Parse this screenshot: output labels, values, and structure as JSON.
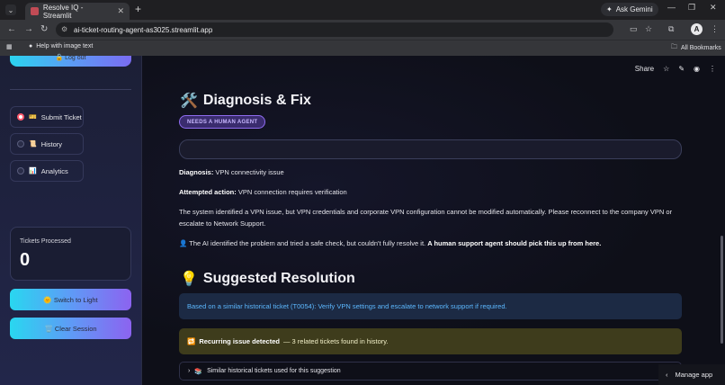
{
  "browser": {
    "tab_title": "Resolve IQ - Streamlit",
    "new_tab": "+",
    "gemini_label": "Ask Gemini",
    "url": "ai-ticket-routing-agent-as3025.streamlit.app",
    "bookmark_help": "Help with image text",
    "bookmark_all": "All Bookmarks",
    "profile_initial": "A"
  },
  "sidebar": {
    "logout_label": "🔓 Log out",
    "nav": [
      {
        "icon": "🎫",
        "label": "Submit Ticket",
        "selected": true
      },
      {
        "icon": "📜",
        "label": "History",
        "selected": false
      },
      {
        "icon": "📊",
        "label": "Analytics",
        "selected": false
      }
    ],
    "metric_label": "Tickets Processed",
    "metric_value": "0",
    "switch_label": "🌞 Switch to Light",
    "clear_label": "🗑️ Clear Session"
  },
  "toolbar": {
    "share_label": "Share"
  },
  "main": {
    "diag_icon": "🛠️",
    "diag_title": "Diagnosis & Fix",
    "badge": "NEEDS A HUMAN AGENT",
    "diagnosis_key": "Diagnosis:",
    "diagnosis_val": " VPN connectivity issue",
    "attempt_key": "Attempted action:",
    "attempt_val": " VPN connection requires verification",
    "explain": "The system identified a VPN issue, but VPN credentials and corporate VPN configuration cannot be modified automatically. Please reconnect to the company VPN or escalate to Network Support.",
    "agent_icon": "👤",
    "agent_text": " The AI identified the problem and tried a safe check, but couldn't fully resolve it. ",
    "agent_bold": "A human support agent should pick this up from here.",
    "sugg_icon": "💡",
    "sugg_title": "Suggested Resolution",
    "info_text": "Based on a similar historical ticket (T0054): Verify VPN settings and escalate to network support if required.",
    "warn_icon": "🔁",
    "warn_bold": "Recurring issue detected",
    "warn_rest": " — 3 related tickets found in history.",
    "expander_icon": "📚",
    "expander_label": "Similar historical tickets used for this suggestion"
  },
  "manage_label": "Manage app"
}
